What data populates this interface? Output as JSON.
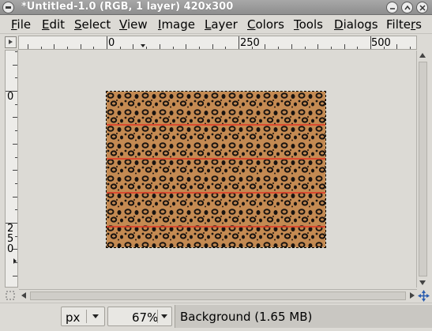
{
  "window": {
    "title": "*Untitled-1.0 (RGB, 1 layer) 420x300"
  },
  "menubar": {
    "items": [
      {
        "label": "File",
        "accel": "F",
        "rest": "ile"
      },
      {
        "label": "Edit",
        "accel": "E",
        "rest": "dit"
      },
      {
        "label": "Select",
        "accel": "S",
        "rest": "elect"
      },
      {
        "label": "View",
        "accel": "V",
        "rest": "iew"
      },
      {
        "label": "Image",
        "accel": "I",
        "rest": "mage"
      },
      {
        "label": "Layer",
        "accel": "L",
        "rest": "ayer"
      },
      {
        "label": "Colors",
        "accel": "C",
        "rest": "olors"
      },
      {
        "label": "Tools",
        "accel": "T",
        "rest": "ools"
      },
      {
        "label": "Dialogs",
        "accel": "D",
        "rest": "ialogs"
      },
      {
        "label": "Filters",
        "accel": "r",
        "pre": "Filte",
        "rest": "s"
      }
    ]
  },
  "rulers": {
    "horizontal_labels": [
      "0",
      "250",
      "500"
    ],
    "vertical_labels": [
      "0",
      "2",
      "5",
      "0"
    ]
  },
  "statusbar": {
    "unit": "px",
    "zoom": "67%",
    "layer_info": "Background (1.65 MB)"
  },
  "colors": {
    "pattern_base": "#c48a52",
    "pattern_spots": "#1a1410",
    "stripe": "#e0402a",
    "selection_dash": "#e5d80a"
  },
  "icons": {
    "window_menu": "window-menu-icon",
    "minimize": "minimize-icon",
    "maximize": "maximize-icon",
    "close": "close-icon",
    "ruler_menu": "triangle-right-icon",
    "quick_mask": "quick-mask-icon",
    "navigate": "navigate-icon"
  }
}
